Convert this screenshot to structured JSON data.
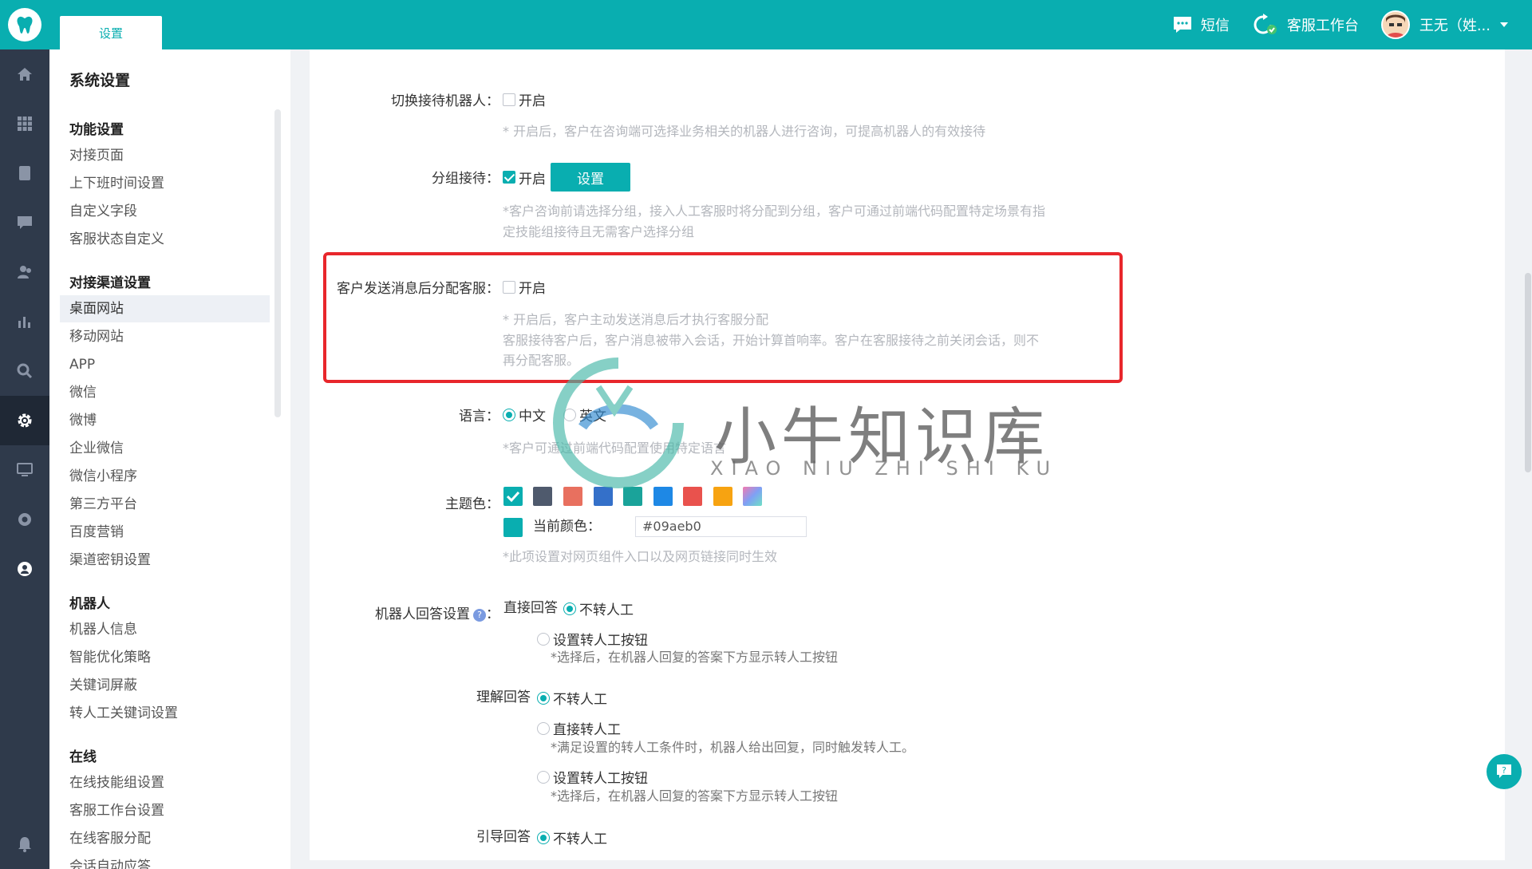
{
  "header": {
    "active_tab": "设置",
    "sms_label": "短信",
    "workbench_label": "客服工作台",
    "user_name": "王无（姓..."
  },
  "sidebar": {
    "title": "系统设置",
    "groups": [
      {
        "label": "功能设置",
        "items": [
          "对接页面",
          "上下班时间设置",
          "自定义字段",
          "客服状态自定义"
        ]
      },
      {
        "label": "对接渠道设置",
        "items": [
          "桌面网站",
          "移动网站",
          "APP",
          "微信",
          "微博",
          "企业微信",
          "微信小程序",
          "第三方平台",
          "百度营销",
          "渠道密钥设置"
        ]
      },
      {
        "label": "机器人",
        "items": [
          "机器人信息",
          "智能优化策略",
          "关键词屏蔽",
          "转人工关键词设置"
        ]
      },
      {
        "label": "在线",
        "items": [
          "在线技能组设置",
          "客服工作台设置",
          "在线客服分配",
          "会话自动应答"
        ]
      }
    ],
    "selected_item": "桌面网站"
  },
  "settings": {
    "switch_robot": {
      "label": "切换接待机器人：",
      "option": "开启",
      "checked": false,
      "hint": "* 开启后，客户在咨询端可选择业务相关的机器人进行咨询，可提高机器人的有效接待"
    },
    "group_reception": {
      "label": "分组接待：",
      "option": "开启",
      "checked": true,
      "button": "设置",
      "hint_line1": "*客户咨询前请选择分组，接入人工客服时将分配到分组，客户可通过前端代码配置特定场景有指",
      "hint_line2": "定技能组接待且无需客户选择分组"
    },
    "assign_after_message": {
      "label": "客户发送消息后分配客服：",
      "option": "开启",
      "checked": false,
      "hint_line1": "* 开启后，客户主动发送消息后才执行客服分配",
      "hint_line2": "客服接待客户后，客户消息被带入会话，开始计算首响率。客户在客服接待之前关闭会话，则不",
      "hint_line3": "再分配客服。"
    },
    "language": {
      "label": "语言：",
      "options": [
        "中文",
        "英文"
      ],
      "selected": "中文",
      "hint": "*客户可通过前端代码配置使用特定语言"
    },
    "theme": {
      "label": "主题色：",
      "colors": [
        "#09aeb0",
        "#4f5a6d",
        "#e8705f",
        "#3470c9",
        "#1aa39a",
        "#1e88e5",
        "#e9524d",
        "#f7a311",
        "#7fa0f5"
      ],
      "current_label": "当前颜色：",
      "current_value": "#09aeb0",
      "hint": "*此项设置对网页组件入口以及网页链接同时生效"
    },
    "robot_reply": {
      "label": "机器人回答设置",
      "sections": [
        {
          "title": "直接回答",
          "options": [
            "不转人工",
            "设置转人工按钮"
          ],
          "hints": [
            "",
            "*选择后，在机器人回复的答案下方显示转人工按钮"
          ]
        },
        {
          "title": "理解回答",
          "options": [
            "不转人工",
            "直接转人工",
            "设置转人工按钮"
          ],
          "hints": [
            "",
            "*满足设置的转人工条件时，机器人给出回复，同时触发转人工。",
            "*选择后，在机器人回复的答案下方显示转人工按钮"
          ]
        },
        {
          "title": "引导回答",
          "options": [
            "不转人工"
          ],
          "hints": [
            ""
          ]
        }
      ]
    }
  },
  "watermark": {
    "title": "小牛知识库",
    "subtitle": "XIAO NIU ZHI SHI KU"
  }
}
